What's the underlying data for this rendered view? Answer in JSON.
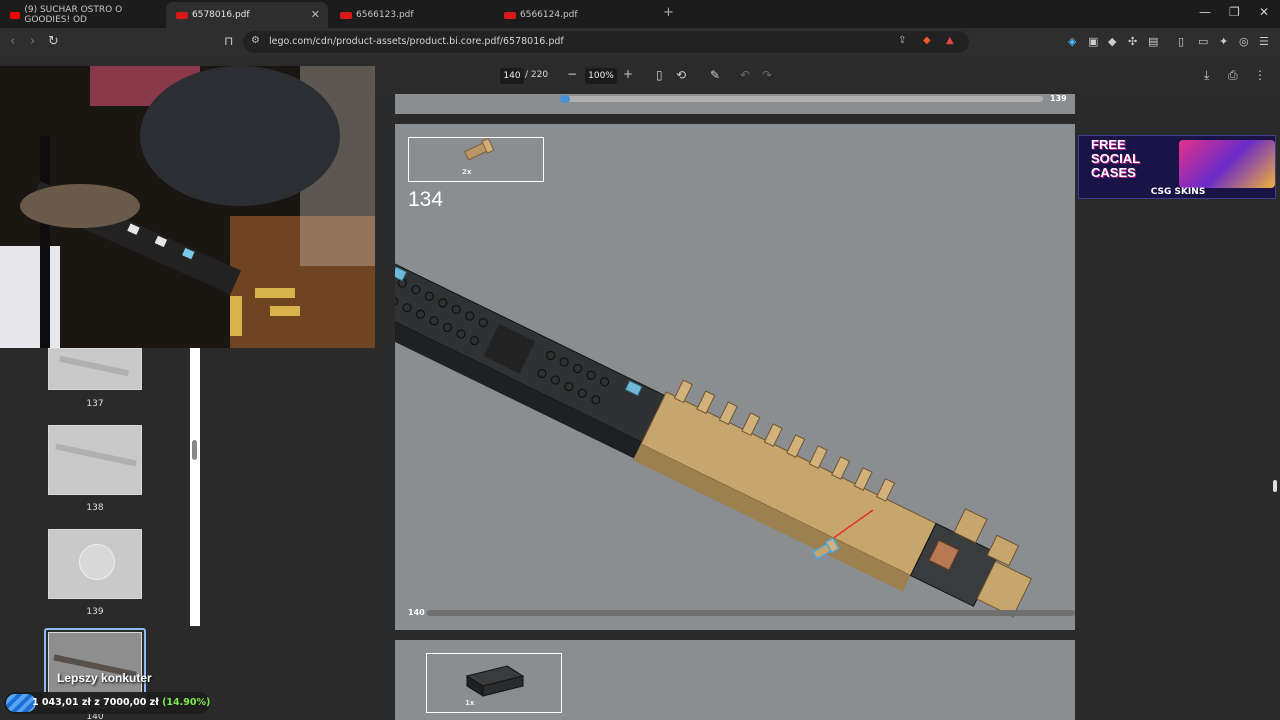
{
  "tabs": [
    {
      "title": "(9) SUCHAR OSTRO O GOODIES! OD",
      "favicon_color": "#ff0000",
      "active": false
    },
    {
      "title": "6578016.pdf",
      "favicon_color": "#d61a1a",
      "active": true
    },
    {
      "title": "6566123.pdf",
      "favicon_color": "#d61a1a",
      "active": false
    },
    {
      "title": "6566124.pdf",
      "favicon_color": "#d61a1a",
      "active": false
    }
  ],
  "address_bar": {
    "url": "lego.com/cdn/product-assets/product.bi.core.pdf/6578016.pdf"
  },
  "pdf_toolbar": {
    "current_page": "140",
    "total_pages": "/ 220",
    "zoom": "100%"
  },
  "sidebar": {
    "thumbnails": [
      {
        "label": "137"
      },
      {
        "label": "138"
      },
      {
        "label": "139"
      },
      {
        "label": "140"
      }
    ]
  },
  "document": {
    "prev_page_number": "139",
    "current": {
      "step_number": "134",
      "part_quantity": "2x",
      "page_number": "140"
    },
    "next": {
      "part_quantity": "1x"
    }
  },
  "ad": {
    "headline": "FREE SOCIAL CASES",
    "line1": "FREE",
    "line2": "SOCIAL",
    "line3": "CASES",
    "brand": "CSG SKINS"
  },
  "stream_overlay": {
    "goal_name": "Lepszy konkuter",
    "current": "1 043,01 zł",
    "separator": "z",
    "target": "7000,00 zł",
    "percent": "(14.90%)",
    "progress_fraction": 0.149
  },
  "colors": {
    "accent": "#8fb8f5",
    "lego_tan": "#c9a56a",
    "lego_black": "#2c2c2c",
    "lego_blue": "#6fb8d8"
  }
}
